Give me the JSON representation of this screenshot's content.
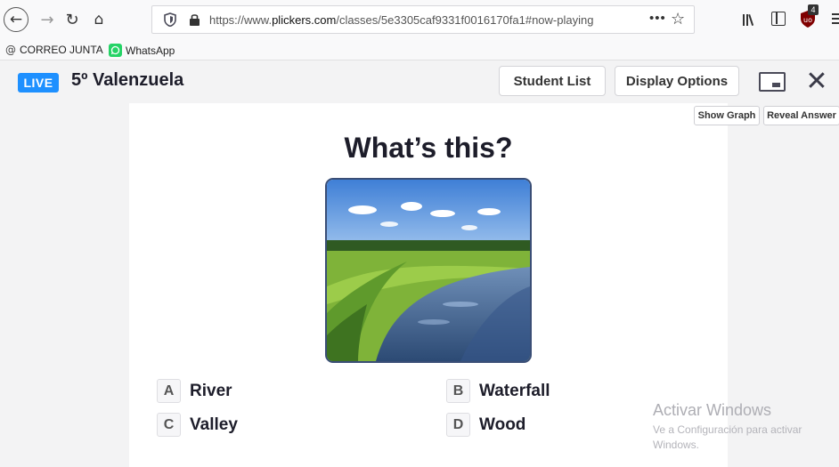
{
  "browser": {
    "url_prefix": "https://www.",
    "url_domain": "plickers.com",
    "url_path": "/classes/5e3305caf9331f0016170fa1#now-playing",
    "more_label": "•••",
    "ublock_count": "4"
  },
  "bookmarks": [
    {
      "label": "CORREO JUNTA"
    },
    {
      "label": "WhatsApp"
    }
  ],
  "header": {
    "live_label": "LIVE",
    "class_name": "5º Valenzuela",
    "student_list_label": "Student List",
    "display_options_label": "Display Options"
  },
  "side_buttons": {
    "show_graph": "Show Graph",
    "reveal_answer": "Reveal Answer"
  },
  "slide": {
    "question": "What’s this?",
    "choices": [
      {
        "letter": "A",
        "text": "River"
      },
      {
        "letter": "B",
        "text": "Waterfall"
      },
      {
        "letter": "C",
        "text": "Valley"
      },
      {
        "letter": "D",
        "text": "Wood"
      }
    ]
  },
  "watermark": {
    "title": "Activar Windows",
    "line1": "Ve a Configuración para activar",
    "line2": "Windows."
  },
  "colors": {
    "live_badge": "#1e90ff",
    "question_text": "#1d1d2a",
    "image_border": "#3a4e76"
  }
}
